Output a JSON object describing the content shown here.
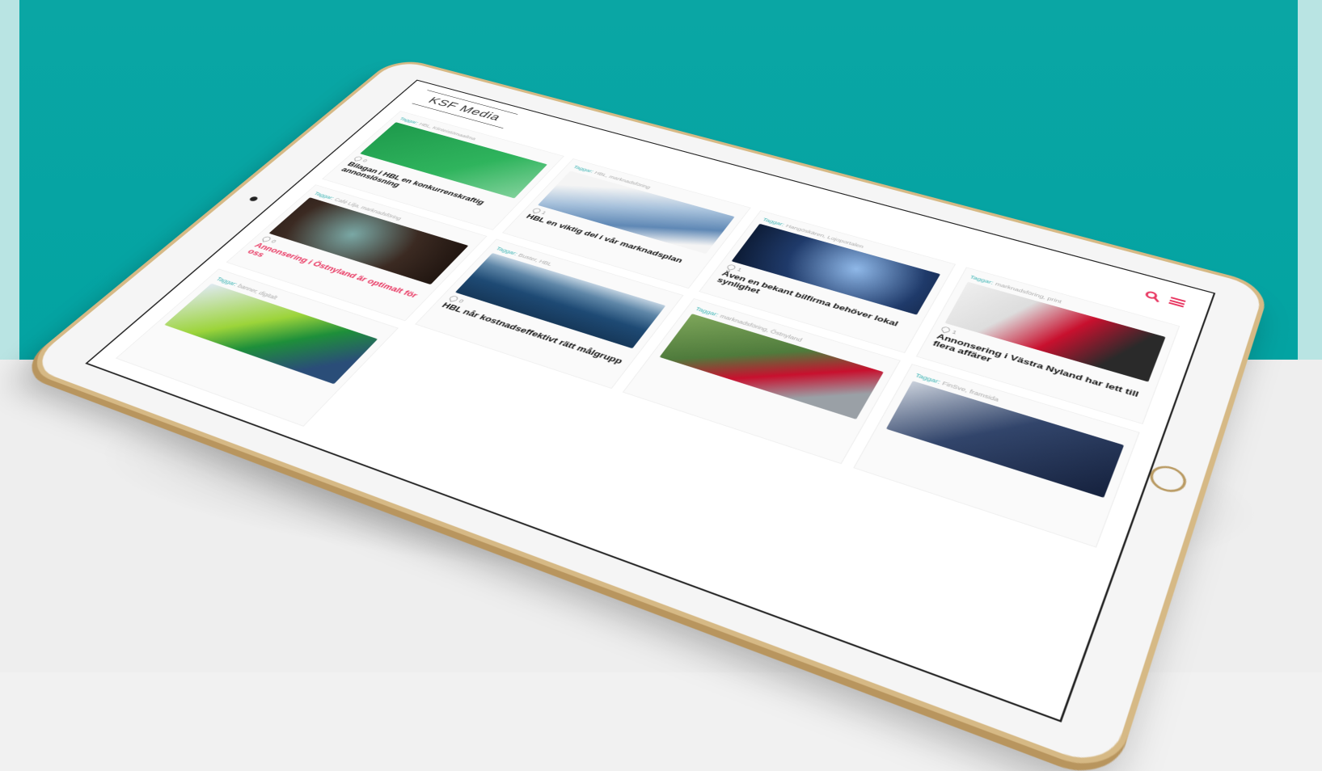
{
  "app": {
    "logo": "KSF Media"
  },
  "colors": {
    "accent": "#e83560",
    "tag": "#3cb4b4",
    "background_top": "#03a3a2"
  },
  "header": {
    "search_icon": "search-icon",
    "menu_icon": "menu-icon"
  },
  "cards": [
    {
      "tags_prefix": "Taggar:",
      "tags": "HBL, Kiinteistömaailma",
      "likes": "0",
      "title": "Bilagan i HBL en konkurrenskraftig annonslösning",
      "image": "km",
      "pink": false
    },
    {
      "tags_prefix": "Taggar:",
      "tags": "HBL, marknadsföring",
      "likes": "1",
      "title": "HBL en viktig del i vår marknadsplan",
      "image": "mac",
      "pink": false
    },
    {
      "tags_prefix": "Taggar:",
      "tags": "Hangöskären, Lojoportalen",
      "likes": "1",
      "title": "Även en bekant bilfirma behöver lokal synlighet",
      "image": "car",
      "pink": false
    },
    {
      "tags_prefix": "Taggar:",
      "tags": "marknadsföring, print",
      "likes": "1",
      "title": "Annonsering i Västra Nyland har lett till flera affärer",
      "image": "red",
      "pink": false
    },
    {
      "tags_prefix": "Taggar:",
      "tags": "Café Lilja, marknadsföring",
      "likes": "0",
      "title": "Annonsering i Östnyland är optimalt för oss",
      "image": "cafe",
      "pink": true
    },
    {
      "tags_prefix": "Taggar:",
      "tags": "Buster, HBL",
      "likes": "0",
      "title": "HBL når kostnadseffektivt rätt målgrupp",
      "image": "sea",
      "pink": false
    },
    {
      "tags_prefix": "Taggar:",
      "tags": "marknadsföring, Östnyland",
      "likes": "",
      "title": "",
      "image": "road",
      "pink": false
    },
    {
      "tags_prefix": "Taggar:",
      "tags": "FinSve, framsida",
      "likes": "",
      "title": "",
      "image": "finsve",
      "pink": false
    },
    {
      "tags_prefix": "Taggar:",
      "tags": "banner, digitalt",
      "likes": "",
      "title": "",
      "image": "chair",
      "pink": false
    }
  ]
}
